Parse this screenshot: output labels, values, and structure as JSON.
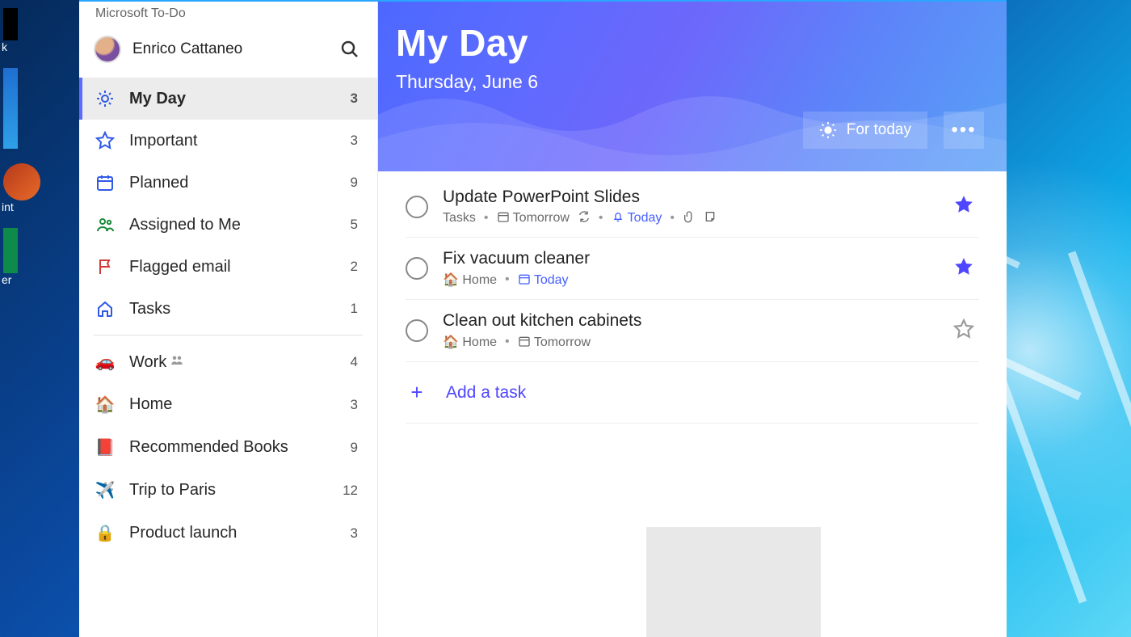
{
  "app_title": "Microsoft To-Do",
  "user_name": "Enrico Cattaneo",
  "sidebar": {
    "smart": [
      {
        "icon": "sun",
        "label": "My Day",
        "count": "3",
        "active": true
      },
      {
        "icon": "star",
        "label": "Important",
        "count": "3"
      },
      {
        "icon": "cal",
        "label": "Planned",
        "count": "9"
      },
      {
        "icon": "assign",
        "label": "Assigned to Me",
        "count": "5"
      },
      {
        "icon": "flag",
        "label": "Flagged email",
        "count": "2"
      },
      {
        "icon": "home",
        "label": "Tasks",
        "count": "1"
      }
    ],
    "lists": [
      {
        "emoji": "🚗",
        "label": "Work",
        "count": "4",
        "shared": true
      },
      {
        "emoji": "🏠",
        "label": "Home",
        "count": "3"
      },
      {
        "emoji": "📕",
        "label": "Recommended Books",
        "count": "9"
      },
      {
        "emoji": "✈️",
        "label": "Trip to Paris",
        "count": "12"
      },
      {
        "emoji": "🔒",
        "label": "Product launch",
        "count": "3"
      }
    ]
  },
  "header": {
    "title": "My Day",
    "date": "Thursday, June 6",
    "for_today": "For today"
  },
  "tasks": [
    {
      "title": "Update PowerPoint Slides",
      "list": "Tasks",
      "list_emoji": "",
      "due_label": "Tomorrow",
      "due_blue": false,
      "repeat": true,
      "reminder": "Today",
      "attach": true,
      "note": true,
      "starred": true
    },
    {
      "title": "Fix vacuum cleaner",
      "list": "Home",
      "list_emoji": "🏠",
      "due_label": "Today",
      "due_blue": true,
      "repeat": false,
      "reminder": "",
      "attach": false,
      "note": false,
      "starred": true
    },
    {
      "title": "Clean out kitchen cabinets",
      "list": "Home",
      "list_emoji": "🏠",
      "due_label": "Tomorrow",
      "due_blue": false,
      "repeat": false,
      "reminder": "",
      "attach": false,
      "note": false,
      "starred": false
    }
  ],
  "add_task": "Add a task",
  "desktop_labels": [
    "k",
    "",
    "int",
    "",
    "er"
  ]
}
